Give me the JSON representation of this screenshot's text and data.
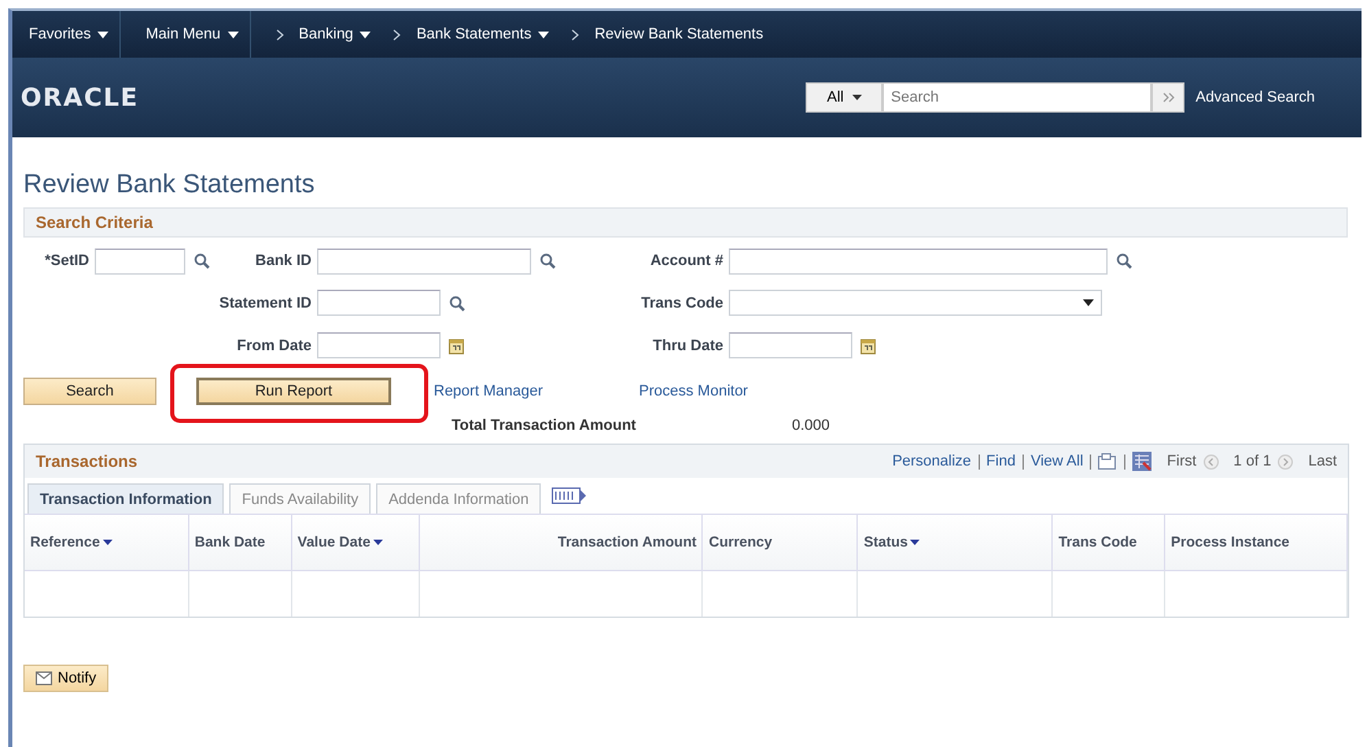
{
  "nav": [
    {
      "label": "Favorites",
      "dropdown": true,
      "chevron": false
    },
    {
      "label": "Main Menu",
      "dropdown": true,
      "chevron": false
    },
    {
      "label": "Banking",
      "dropdown": true,
      "chevron": true
    },
    {
      "label": "Bank Statements",
      "dropdown": true,
      "chevron": true
    },
    {
      "label": "Review Bank Statements",
      "dropdown": false,
      "chevron": true
    }
  ],
  "header": {
    "logo": "ORACLE",
    "search_scope": "All",
    "search_placeholder": "Search",
    "advanced_search": "Advanced Search"
  },
  "page_title": "Review Bank Statements",
  "search_criteria": {
    "title": "Search Criteria",
    "fields": [
      {
        "label": "*SetID",
        "kind": "lookup"
      },
      {
        "label": "Bank ID",
        "kind": "lookup"
      },
      {
        "label": "Account #",
        "kind": "lookup"
      },
      {
        "label": "Statement ID",
        "kind": "lookup"
      },
      {
        "label": "Trans Code",
        "kind": "select"
      },
      {
        "label": "From Date",
        "kind": "date"
      },
      {
        "label": "Thru Date",
        "kind": "date"
      }
    ]
  },
  "buttons": [
    {
      "label": "Search",
      "highlighted": false
    },
    {
      "label": "Run Report",
      "highlighted": true
    }
  ],
  "links": [
    "Report Manager",
    "Process Monitor"
  ],
  "total": {
    "label": "Total Transaction Amount",
    "value": "0.000"
  },
  "transactions": {
    "title": "Transactions",
    "tools": [
      "Personalize",
      "Find",
      "View All"
    ],
    "pager": {
      "first": "First",
      "position": "1 of 1",
      "last": "Last"
    },
    "tabs": [
      {
        "label": "Transaction Information",
        "selected": true
      },
      {
        "label": "Funds Availability",
        "selected": false
      },
      {
        "label": "Addenda Information",
        "selected": false
      }
    ],
    "columns": [
      {
        "label": "Reference",
        "sortable": true
      },
      {
        "label": "Bank Date",
        "sortable": false
      },
      {
        "label": "Value Date",
        "sortable": true
      },
      {
        "label": "Transaction Amount",
        "sortable": false
      },
      {
        "label": "Currency",
        "sortable": false
      },
      {
        "label": "Status",
        "sortable": true
      },
      {
        "label": "Trans Code",
        "sortable": false
      },
      {
        "label": "Process Instance",
        "sortable": false
      }
    ]
  },
  "notify_button": "Notify"
}
